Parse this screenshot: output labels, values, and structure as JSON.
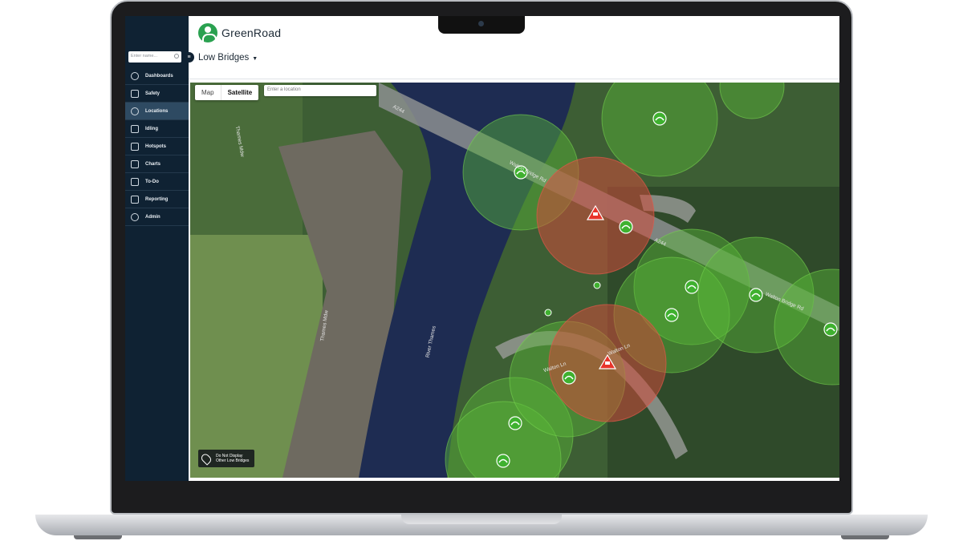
{
  "app": {
    "brand": "GreenRoad",
    "page_title": "Low Bridges"
  },
  "sidebar": {
    "search_placeholder": "Enter name...",
    "items": [
      {
        "label": "Dashboards",
        "icon": "gauge-icon"
      },
      {
        "label": "Safety",
        "icon": "shield-icon"
      },
      {
        "label": "Locations",
        "icon": "location-pin-icon",
        "active": true
      },
      {
        "label": "Idling",
        "icon": "idling-icon"
      },
      {
        "label": "Hotspots",
        "icon": "hotspot-flag-icon"
      },
      {
        "label": "Charts",
        "icon": "chart-icon"
      },
      {
        "label": "To-Do",
        "icon": "checklist-icon"
      },
      {
        "label": "Reporting",
        "icon": "report-icon"
      },
      {
        "label": "Admin",
        "icon": "gear-icon"
      }
    ]
  },
  "map": {
    "type_options": [
      "Map",
      "Satellite"
    ],
    "selected_type": "Satellite",
    "location_placeholder": "Enter a location",
    "legend_button": "Do Not Display Other Low Bridges",
    "labels": {
      "a244": "A244",
      "a244_b": "A244",
      "walton_bridge_rd": "Walton Bridge Rd",
      "walton_bridge_rd_b": "Walton Bridge Rd",
      "walton_ln": "Walton Ln",
      "walton_ln_b": "Walton Ln",
      "river_thames": "River Thames",
      "thames_mdw": "Thames Mdw",
      "thames_mdw_b": "Thames Mdw"
    },
    "marker_colors": {
      "safe": "#3fb12f",
      "warning": "#e8342a"
    }
  }
}
